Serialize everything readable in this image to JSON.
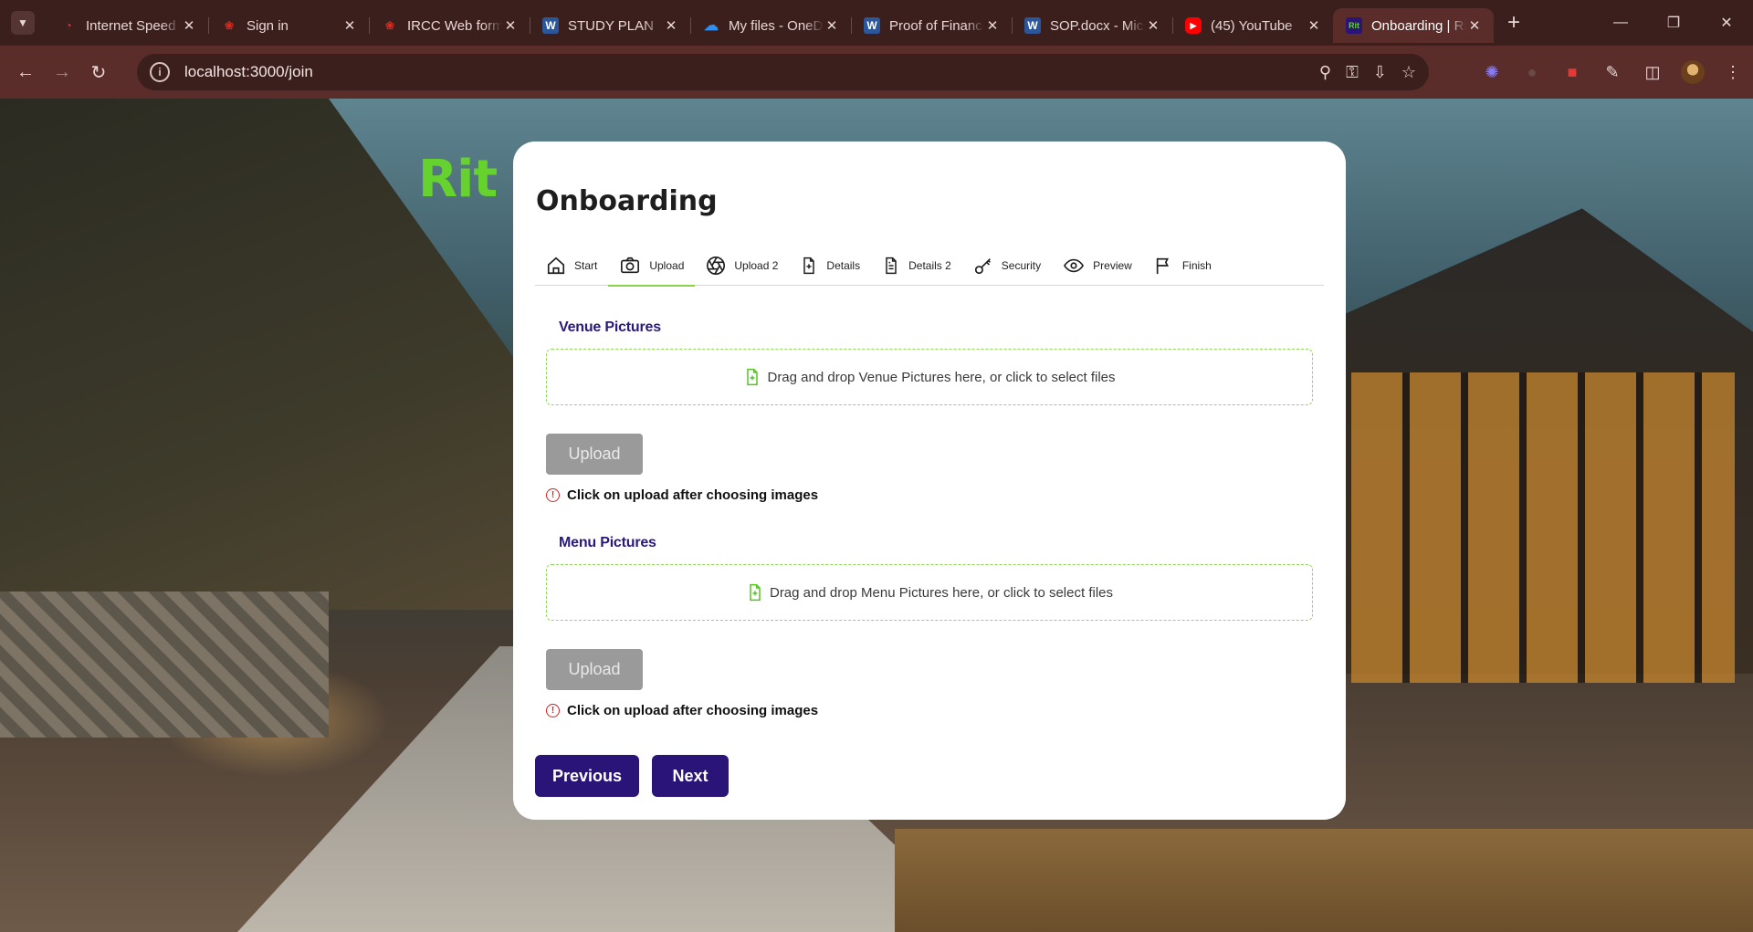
{
  "browser": {
    "tabs": [
      {
        "title": "Internet Speed Test",
        "favicon": "speedometer-icon",
        "color": "#e53935"
      },
      {
        "title": "Sign in",
        "favicon": "maple-leaf-icon",
        "color": "#d52b1e"
      },
      {
        "title": "IRCC Web form",
        "favicon": "maple-leaf-icon",
        "color": "#d52b1e"
      },
      {
        "title": "STUDY PLAN",
        "favicon": "word-icon",
        "color": "#2b579a"
      },
      {
        "title": "My files - OneDrive",
        "favicon": "onedrive-icon",
        "color": "#0a73d6"
      },
      {
        "title": "Proof of Finances",
        "favicon": "word-icon",
        "color": "#2b579a"
      },
      {
        "title": "SOP.docx - Microsoft Word",
        "favicon": "word-icon",
        "color": "#2b579a"
      },
      {
        "title": "(45) YouTube",
        "favicon": "youtube-icon",
        "color": "#ff0000"
      },
      {
        "title": "Onboarding | Rit",
        "favicon": "rit-logo-icon",
        "color": "#2b1478",
        "active": true
      }
    ],
    "url": "localhost:3000/join"
  },
  "brand": {
    "logo_text": "Rit",
    "color": "#66d22e"
  },
  "card": {
    "title": "Onboarding",
    "steps": [
      {
        "label": "Start",
        "icon": "home-icon"
      },
      {
        "label": "Upload",
        "icon": "camera-icon",
        "active": true
      },
      {
        "label": "Upload 2",
        "icon": "aperture-icon"
      },
      {
        "label": "Details",
        "icon": "file-plus-icon"
      },
      {
        "label": "Details 2",
        "icon": "file-text-icon"
      },
      {
        "label": "Security",
        "icon": "key-icon"
      },
      {
        "label": "Preview",
        "icon": "eye-icon"
      },
      {
        "label": "Finish",
        "icon": "flag-icon"
      }
    ],
    "venue": {
      "label": "Venue Pictures",
      "dropzone_text": "Drag and drop Venue Pictures here, or click to select files",
      "upload_label": "Upload",
      "hint": "Click on upload after choosing images"
    },
    "menu": {
      "label": "Menu Pictures",
      "dropzone_text": "Drag and drop Menu Pictures here, or click to select files",
      "upload_label": "Upload",
      "hint": "Click on upload after choosing images"
    },
    "previous_label": "Previous",
    "next_label": "Next"
  },
  "colors": {
    "primary": "#2b1478",
    "accent": "#8ad24a",
    "section_label": "#2a1a7a",
    "warning": "#d61f1f"
  }
}
